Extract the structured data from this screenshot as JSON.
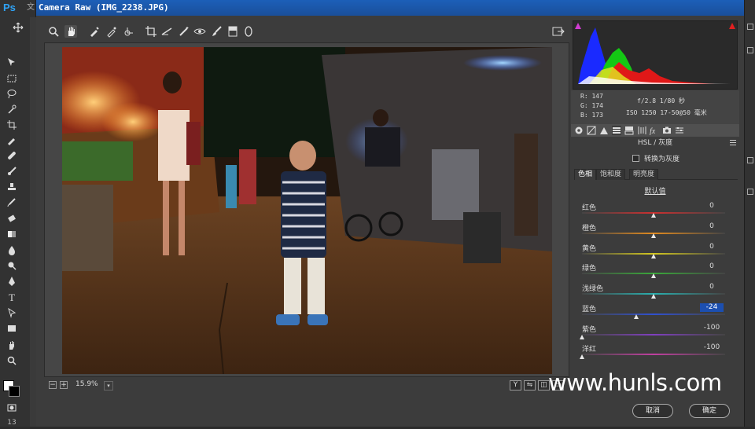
{
  "ps": {
    "logo": "Ps",
    "title_fragment": "文",
    "bottom_number": "13"
  },
  "dialog": {
    "title": "Camera Raw (IMG_2238.JPG)"
  },
  "toolbar": {
    "tools": [
      "zoom-tool",
      "hand-tool",
      "white-balance-tool",
      "color-sampler-tool",
      "targeted-adjustment-tool",
      "crop-tool",
      "straighten-tool",
      "spot-removal-tool",
      "red-eye-tool",
      "adjustment-brush",
      "graduated-filter",
      "radial-filter"
    ]
  },
  "histogram": {
    "rgb_labels": {
      "r": "R: 147",
      "g": "G: 174",
      "b": "B: 173"
    },
    "exposure": "f/2.8  1/80 秒",
    "iso": "ISO 1250  17-50@50 毫米"
  },
  "hsl": {
    "section_title": "HSL / 灰度",
    "gray_toggle": "转换为灰度",
    "tabs": [
      "色相",
      "饱和度",
      "明亮度"
    ],
    "defaults": "默认值",
    "sliders": [
      {
        "label": "红色",
        "value": "0",
        "pos": 0.5,
        "color": "#cc3030"
      },
      {
        "label": "橙色",
        "value": "0",
        "pos": 0.5,
        "color": "#e08a20"
      },
      {
        "label": "黄色",
        "value": "0",
        "pos": 0.5,
        "color": "#d4c820"
      },
      {
        "label": "绿色",
        "value": "0",
        "pos": 0.5,
        "color": "#3aa83a"
      },
      {
        "label": "浅绿色",
        "value": "0",
        "pos": 0.5,
        "color": "#2ab0b0"
      },
      {
        "label": "蓝色",
        "value": "-24",
        "pos": 0.38,
        "color": "#3050d0",
        "focused": true
      },
      {
        "label": "紫色",
        "value": "-100",
        "pos": 0.0,
        "color": "#8040c0"
      },
      {
        "label": "洋红",
        "value": "-100",
        "pos": 0.0,
        "color": "#c040a0"
      }
    ]
  },
  "status": {
    "zoom": "15.9%",
    "view_buttons": [
      "Y",
      "⇋",
      "◫",
      "▭"
    ]
  },
  "buttons": {
    "cancel": "取消",
    "ok": "确定"
  },
  "watermark": "www.hunls.com"
}
